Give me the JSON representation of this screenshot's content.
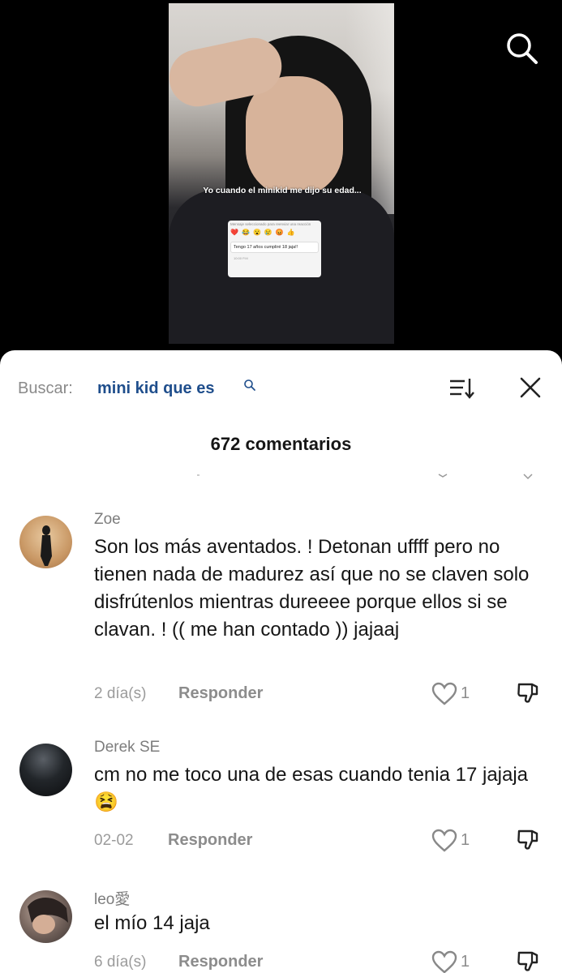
{
  "video": {
    "caption": "Yo cuando el minikid me dijo su edad...",
    "card": {
      "hint": "Mensaje seleccionado para reenviar una reacción",
      "emojis": [
        "❤️",
        "😂",
        "😮",
        "😢",
        "😡",
        "👍"
      ],
      "message": "Tengo 17 años cumpliré 18 jaja!!",
      "time": "10:00 P.M"
    }
  },
  "header": {
    "search_label": "Buscar:",
    "search_query": "mini kid que es",
    "comments_count": "672 comentarios"
  },
  "comments": [
    {
      "username": "Zoe",
      "text": "Son los más aventados. ! Detonan uffff pero no tienen nada de madurez así que no se claven solo disfrútenlos mientras dureeee porque ellos si se clavan. ! (( me han contado )) jajaaj",
      "date": "2 día(s)",
      "reply_label": "Responder",
      "likes": "1"
    },
    {
      "username": "Derek SE",
      "text": "cm no me toco una de esas cuando tenia 17 jajaja😫",
      "date": "02-02",
      "reply_label": "Responder",
      "likes": "1"
    },
    {
      "username": "leo愛",
      "text": "el mío 14 jaja",
      "date": "6 día(s)",
      "reply_label": "Responder",
      "likes": "1"
    }
  ],
  "colors": {
    "query": "#1f4e8c",
    "muted": "#8c8c8c",
    "text": "#161616"
  },
  "icons": [
    "search-icon",
    "sort-icon",
    "close-icon",
    "heart-icon",
    "dislike-icon"
  ]
}
